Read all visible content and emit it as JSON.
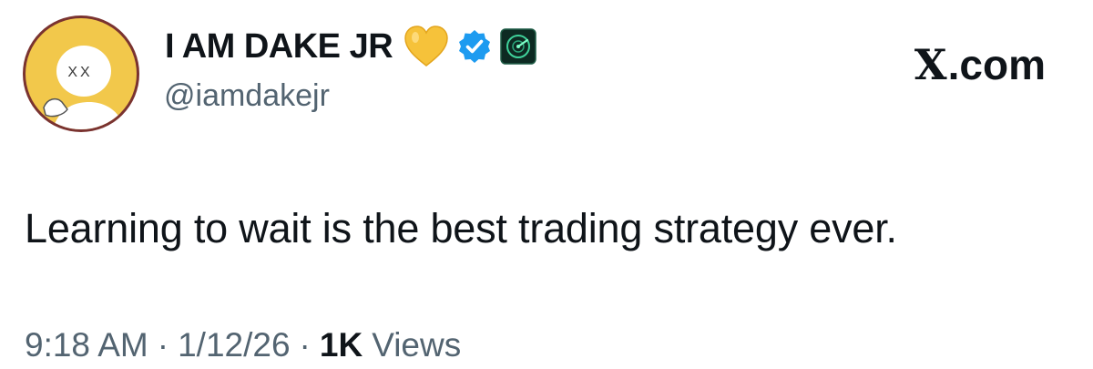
{
  "author": {
    "display_name": "I AM DAKE JR",
    "handle": "@iamdakejr",
    "avatar_text": "XX",
    "badges": [
      "yellow-heart-icon",
      "verified-badge-icon",
      "affiliate-badge-icon"
    ]
  },
  "brand": {
    "label": ".com",
    "mark": "X"
  },
  "tweet": {
    "text": "Learning to wait is the best trading strategy ever."
  },
  "meta": {
    "time": "9:18 AM",
    "date": "1/12/26",
    "separator": "·",
    "views_count": "1K",
    "views_label": "Views"
  },
  "colors": {
    "text_primary": "#0f1419",
    "text_secondary": "#536471",
    "verified_blue": "#1d9bf0",
    "avatar_yellow": "#f2c84b",
    "heart_yellow": "#f6c23a"
  }
}
